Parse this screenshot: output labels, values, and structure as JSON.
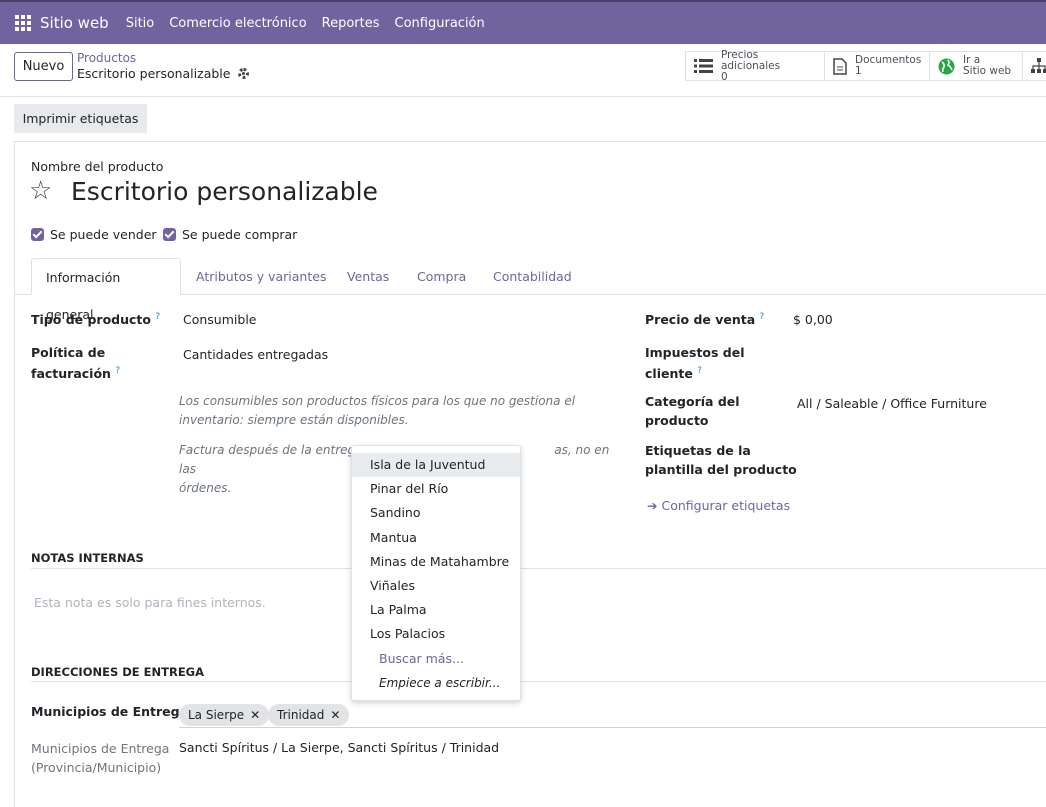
{
  "nav": {
    "brand": "Sitio web",
    "menu": [
      "Sitio",
      "Comercio electrónico",
      "Reportes",
      "Configuración"
    ]
  },
  "control": {
    "new_label": "Nuevo",
    "breadcrumb": "Productos",
    "record_title": "Escritorio personalizable",
    "smart_buttons": [
      {
        "icon": "list-icon",
        "label": "Precios adicionales",
        "value": "0"
      },
      {
        "icon": "document-icon",
        "label": "Documentos",
        "value": "1"
      },
      {
        "icon": "globe-icon",
        "label": "Ir a",
        "value": "Sitio web"
      },
      {
        "icon": "sitemap-icon",
        "label": "",
        "value": ""
      }
    ]
  },
  "actions": {
    "print_labels": "Imprimir etiquetas"
  },
  "form": {
    "name_label": "Nombre del producto",
    "name": "Escritorio personalizable",
    "can_sell": "Se puede vender",
    "can_buy": "Se puede comprar",
    "tabs": [
      "Información general",
      "Atributos y variantes",
      "Ventas",
      "Compra",
      "Contabilidad"
    ],
    "product_type_label": "Tipo de producto",
    "product_type": "Consumible",
    "invoice_policy_label_1": "Política de",
    "invoice_policy_label_2": "facturación",
    "invoice_policy": "Cantidades entregadas",
    "help_consumable": "Los consumibles son productos físicos para los que no gestiona el inventario: siempre están disponibles.",
    "help_invoice_1": "Factura después de la entrega,",
    "help_invoice_2": "as, no en las",
    "help_invoice_3": "órdenes.",
    "sale_price_label": "Precio de venta",
    "sale_price": "$ 0,00",
    "taxes_label_1": "Impuestos del",
    "taxes_label_2": "cliente",
    "category_label_1": "Categoría del",
    "category_label_2": "producto",
    "category": "All / Saleable / Office Furniture",
    "template_tags_label_1": "Etiquetas de la",
    "template_tags_label_2": "plantilla del producto",
    "configure_tags": "Configurar etiquetas",
    "help_marker": "?"
  },
  "internal_notes": {
    "title": "NOTAS INTERNAS",
    "placeholder": "Esta nota es solo para fines internos."
  },
  "delivery": {
    "title": "DIRECCIONES DE ENTREGA",
    "municipalities_label": "Municipios de Entrega",
    "tags": [
      "La Sierpe",
      "Trinidad"
    ],
    "full_label_1": "Municipios de Entrega",
    "full_label_2": "(Provincia/Municipio)",
    "full_value": "Sancti Spíritus / La Sierpe, Sancti Spíritus / Trinidad"
  },
  "dropdown": {
    "options": [
      "Isla de la Juventud",
      "Pinar del Río",
      "Sandino",
      "Mantua",
      "Minas de Matahambre",
      "Viñales",
      "La Palma",
      "Los Palacios"
    ],
    "search_more": "Buscar más...",
    "hint": "Empiece a escribir..."
  },
  "colors": {
    "primary": "#71639e",
    "nav_bg": "#71639e",
    "link": "#71639e",
    "help": "#1a8fd0"
  }
}
